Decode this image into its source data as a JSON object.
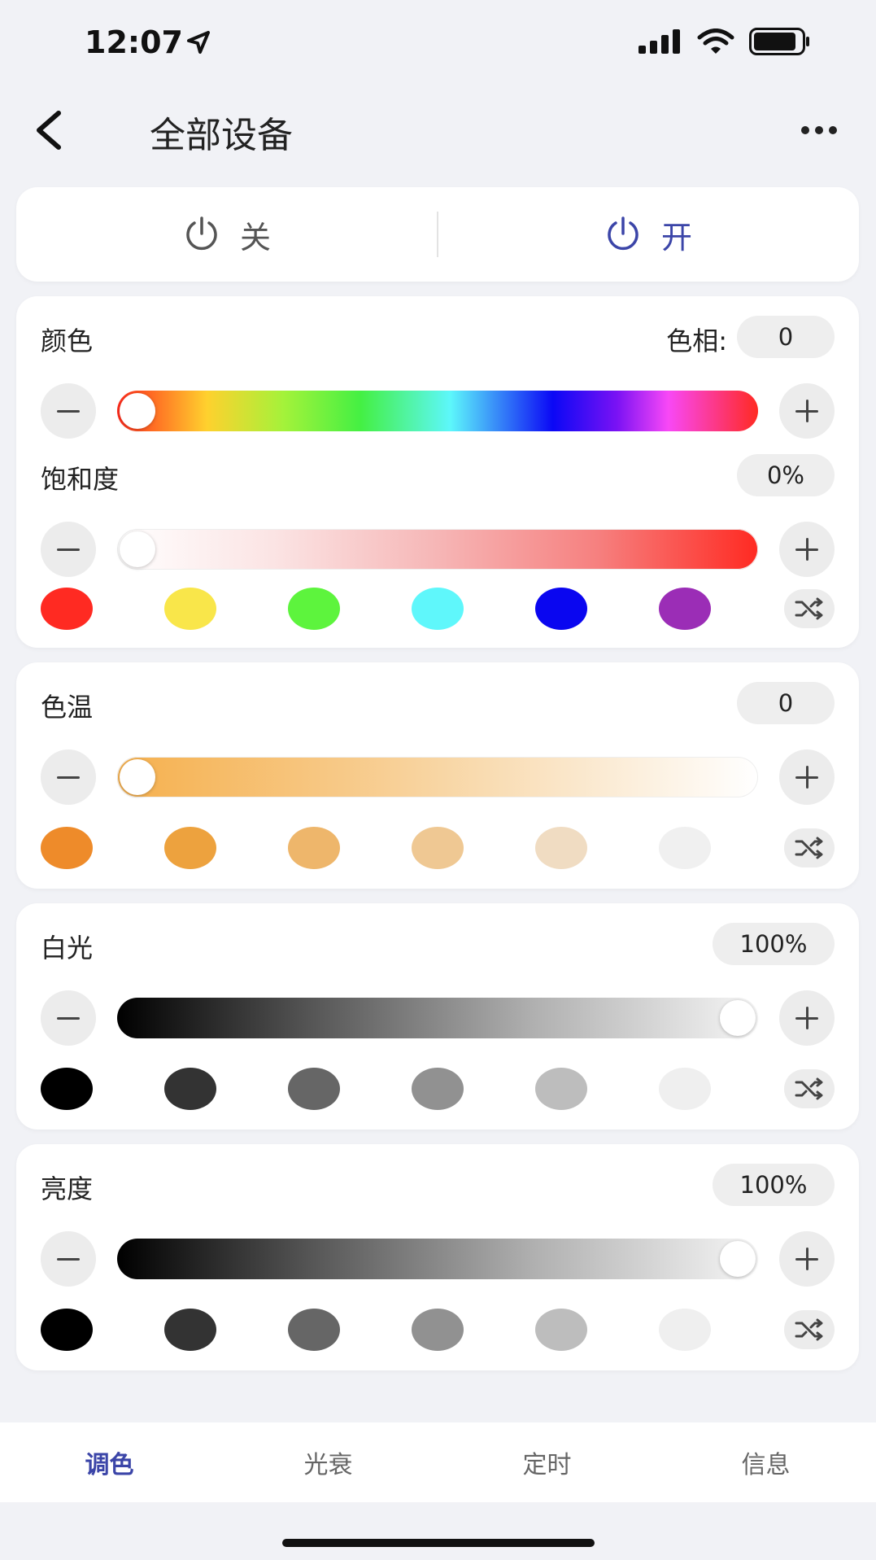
{
  "status_bar": {
    "time": "12:07"
  },
  "header": {
    "title": "全部设备"
  },
  "power": {
    "off_label": "关",
    "on_label": "开",
    "on_color": "#3b45a8"
  },
  "color_section": {
    "label": "颜色",
    "hue_label": "色相:",
    "hue_value": "0",
    "hue_slider": 0,
    "saturation_label": "饱和度",
    "saturation_value": "0%",
    "saturation_slider": 0,
    "swatches": [
      "#ff2a22",
      "#f9e64a",
      "#5df43d",
      "#5ff7fb",
      "#0a06f0",
      "#9b2db6"
    ]
  },
  "temp_section": {
    "label": "色温",
    "value": "0",
    "slider": 0,
    "swatches": [
      "#ee8b2a",
      "#eda23e",
      "#eeb66b",
      "#efc893",
      "#f0dcc2",
      "#f0f0f0"
    ]
  },
  "white_section": {
    "label": "白光",
    "value": "100%",
    "slider": 1.0,
    "swatches": [
      "#000000",
      "#333333",
      "#666666",
      "#919191",
      "#bdbdbd",
      "#efefef"
    ]
  },
  "brightness_section": {
    "label": "亮度",
    "value": "100%",
    "slider": 1.0,
    "swatches": [
      "#000000",
      "#333333",
      "#666666",
      "#919191",
      "#bdbdbd",
      "#efefef"
    ]
  },
  "tabs": [
    {
      "label": "调色",
      "active": true
    },
    {
      "label": "光衰",
      "active": false
    },
    {
      "label": "定时",
      "active": false
    },
    {
      "label": "信息",
      "active": false
    }
  ],
  "accent_color": "#3b45a8"
}
